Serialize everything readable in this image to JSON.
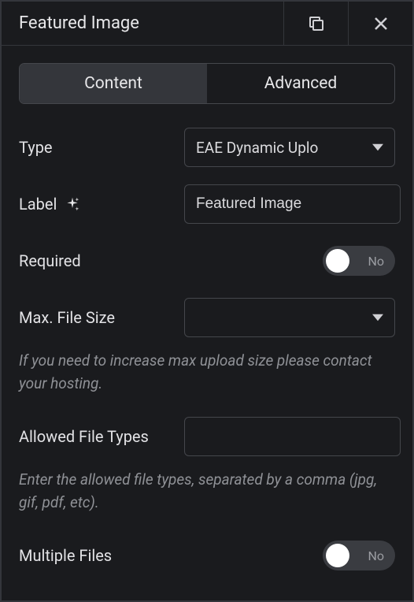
{
  "header": {
    "title": "Featured Image"
  },
  "tabs": {
    "content": "Content",
    "advanced": "Advanced"
  },
  "fields": {
    "type": {
      "label": "Type",
      "value": "EAE Dynamic Uplo"
    },
    "label": {
      "label": "Label",
      "value": "Featured Image"
    },
    "required": {
      "label": "Required",
      "state_text": "No"
    },
    "maxsize": {
      "label": "Max. File Size",
      "value": "",
      "help": "If you need to increase max upload size please contact your hosting."
    },
    "allowed": {
      "label": "Allowed File Types",
      "value": "",
      "help": "Enter the allowed file types, separated by a comma (jpg, gif, pdf, etc)."
    },
    "multiple": {
      "label": "Multiple Files",
      "state_text": "No"
    }
  }
}
